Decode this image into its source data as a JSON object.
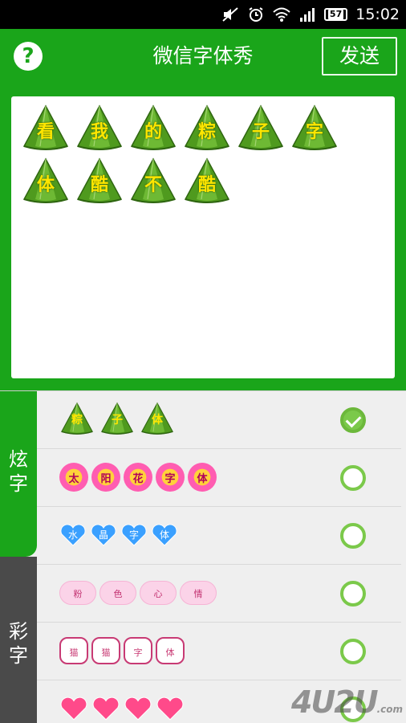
{
  "status_bar": {
    "time": "15:02",
    "battery": "57",
    "icons": [
      "mute-icon",
      "alarm-icon",
      "wifi-icon",
      "signal-icon",
      "battery-icon"
    ]
  },
  "header": {
    "help_label": "?",
    "title": "微信字体秀",
    "send_label": "发送"
  },
  "preview": {
    "chars": [
      "看",
      "我",
      "的",
      "粽",
      "子",
      "字",
      "体",
      "酷",
      "不",
      "酷"
    ]
  },
  "tabs": [
    {
      "label": "炫字",
      "active": true
    },
    {
      "label": "彩字",
      "active": false
    }
  ],
  "styles": [
    {
      "style": "zongzi",
      "chars": [
        "粽",
        "子",
        "体"
      ],
      "selected": true
    },
    {
      "style": "sunflower",
      "chars": [
        "太",
        "阳",
        "花",
        "字",
        "体"
      ],
      "selected": false
    },
    {
      "style": "blue-heart",
      "chars": [
        "水",
        "晶",
        "字",
        "体"
      ],
      "selected": false
    },
    {
      "style": "pink-cloud",
      "chars": [
        "粉",
        "色",
        "心",
        "情"
      ],
      "selected": false
    },
    {
      "style": "cat",
      "chars": [
        "猫",
        "猫",
        "字",
        "体"
      ],
      "selected": false
    },
    {
      "style": "pink-heart",
      "chars": [
        "",
        "",
        "",
        ""
      ],
      "selected": false
    }
  ],
  "watermark": {
    "text": "4U2U",
    "suffix": ".com"
  },
  "colors": {
    "brand_green": "#1aa51a",
    "radio_green": "#7bc94a",
    "tab_inactive": "#4a4a4a"
  }
}
